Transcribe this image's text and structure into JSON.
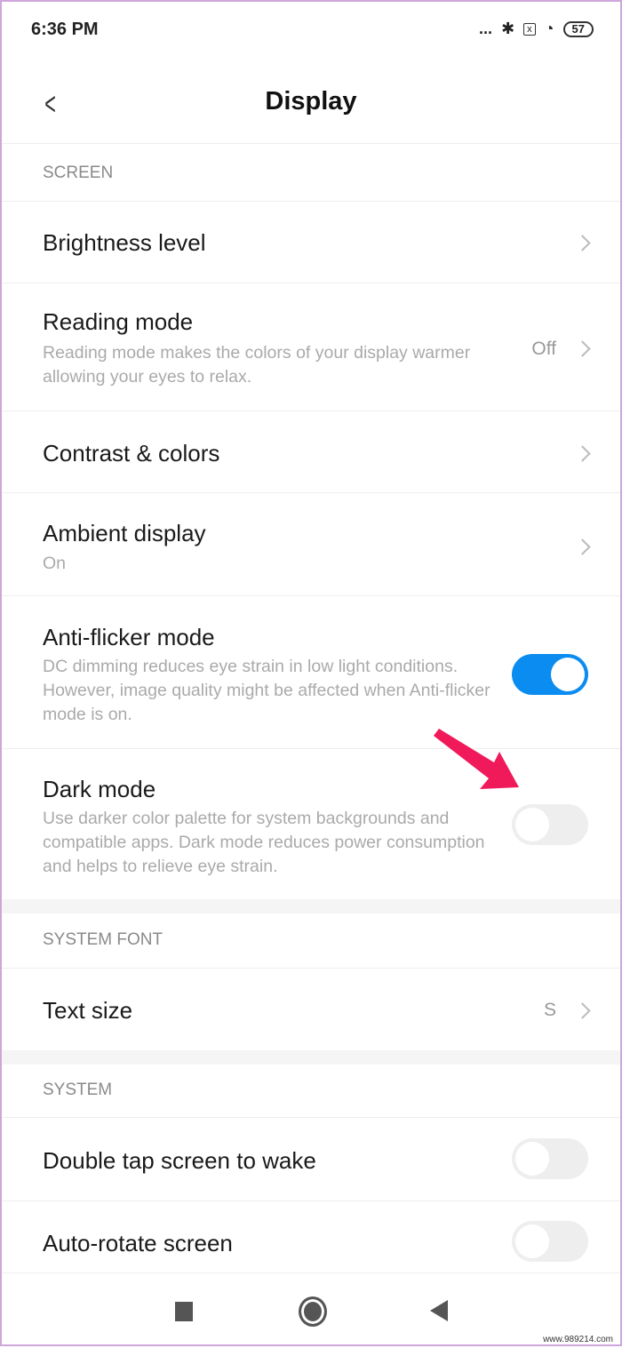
{
  "status_bar": {
    "time": "6:36 PM",
    "dots": "...",
    "battery": "57",
    "icons": [
      "bluetooth-icon",
      "sim-error-icon",
      "wifi-icon",
      "battery-icon"
    ]
  },
  "header": {
    "title": "Display"
  },
  "sections": [
    {
      "header": "SCREEN"
    },
    {
      "header": "SYSTEM FONT"
    },
    {
      "header": "SYSTEM"
    }
  ],
  "rows": {
    "brightness": {
      "title": "Brightness level"
    },
    "reading": {
      "title": "Reading mode",
      "subtitle": "Reading mode makes the colors of your display warmer allowing your eyes to relax.",
      "value": "Off"
    },
    "contrast": {
      "title": "Contrast & colors"
    },
    "ambient": {
      "title": "Ambient display",
      "subtitle": "On"
    },
    "antiflicker": {
      "title": "Anti-flicker mode",
      "subtitle": "DC dimming reduces eye strain in low light conditions. However, image quality might be affected when Anti-flicker mode is on.",
      "on": true
    },
    "dark": {
      "title": "Dark mode",
      "subtitle": "Use darker color palette for system backgrounds and compatible apps. Dark mode reduces power consumption and helps to relieve eye strain.",
      "on": false
    },
    "textsize": {
      "title": "Text size",
      "value": "S"
    },
    "doubletap": {
      "title": "Double tap screen to wake",
      "on": false
    },
    "autorotate": {
      "title": "Auto-rotate screen",
      "on": false
    }
  },
  "colors": {
    "accent": "#0a8cf0",
    "annotation_arrow": "#f0195a"
  },
  "watermark": "www.989214.com"
}
